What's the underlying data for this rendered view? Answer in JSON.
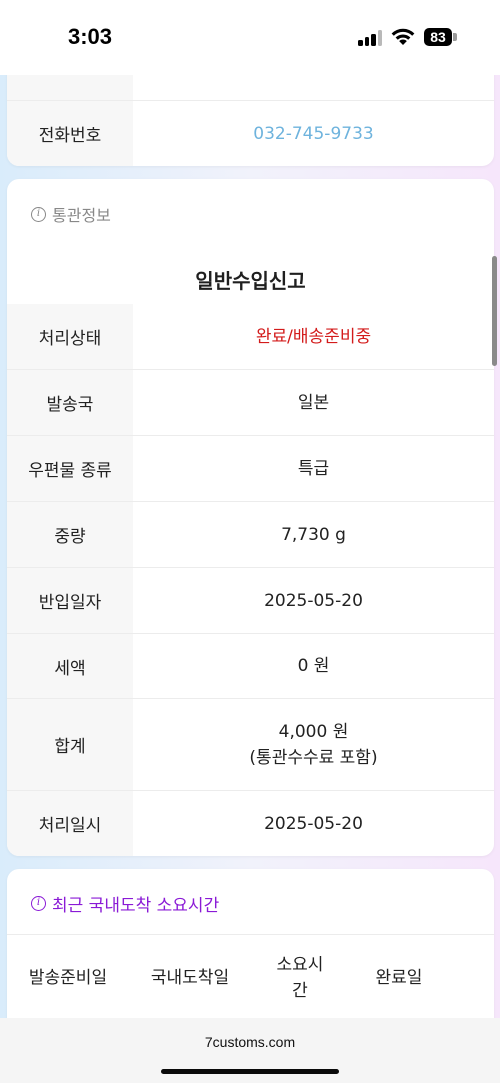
{
  "status_bar": {
    "time": "3:03",
    "battery": "83"
  },
  "contact": {
    "phone_label": "전화번호",
    "phone_value": "032-745-9733"
  },
  "customs": {
    "section_title": "통관정보",
    "declaration_type": "일반수입신고",
    "rows": [
      {
        "label": "처리상태",
        "value": "완료/배송준비중"
      },
      {
        "label": "발송국",
        "value": "일본"
      },
      {
        "label": "우편물 종류",
        "value": "특급"
      },
      {
        "label": "중량",
        "value": "7,730 g"
      },
      {
        "label": "반입일자",
        "value": "2025-05-20"
      },
      {
        "label": "세액",
        "value": "0 원"
      },
      {
        "label": "합계",
        "value": "4,000 원",
        "value_note": "(통관수수료 포함)"
      },
      {
        "label": "처리일시",
        "value": "2025-05-20"
      }
    ]
  },
  "arrival": {
    "section_title": "최근 국내도착 소요시간",
    "columns": [
      "발송준비일",
      "국내도착일",
      "소요시간",
      "완료일"
    ],
    "column_lines": {
      "duration_line1": "소요시",
      "duration_line2": "간"
    }
  },
  "browser": {
    "url": "7customs.com"
  },
  "colors": {
    "link": "#6eb3dd",
    "status_red": "#d31b1b",
    "section_purple": "#8a1ad6"
  }
}
